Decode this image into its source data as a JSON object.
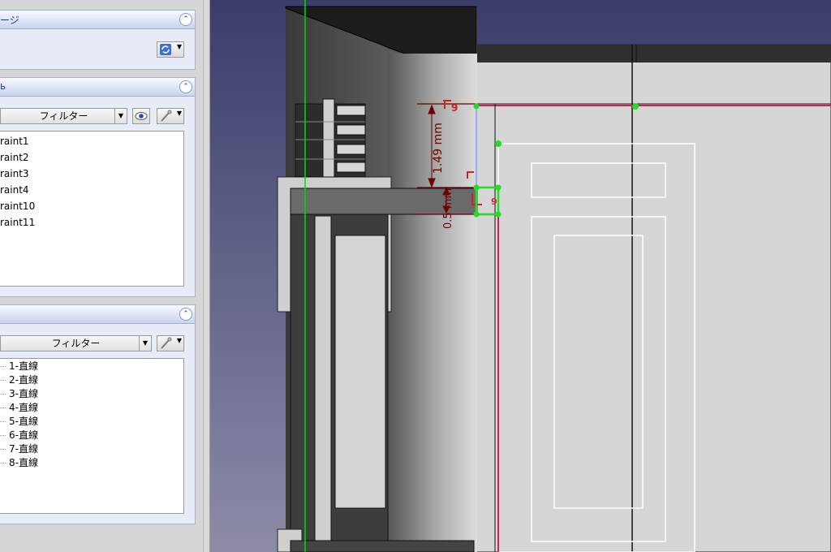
{
  "tasks_panel": {
    "page_title_partial": "ージ"
  },
  "constraints_panel": {
    "title_partial": "ь",
    "filter_label": "フィルター",
    "items": [
      "raint1",
      "raint2",
      "raint3",
      "raint4",
      "raint10",
      "raint11"
    ]
  },
  "elements_panel": {
    "filter_label": "フィルター",
    "items": [
      "1-直線",
      "2-直線",
      "3-直線",
      "4-直線",
      "5-直線",
      "6-直線",
      "7-直線",
      "8-直線"
    ]
  },
  "sketch": {
    "dim_vertical_1": "1.49 mm",
    "dim_vertical_2": "0.5 mm",
    "dim_label_top": "9",
    "dim_label_small": "9",
    "colors": {
      "background_top": "#3a3d6c",
      "background_bottom": "#8c8ca8",
      "axis_green": "#00dd00",
      "constraint_line": "#cc2255",
      "dimension": "#6e0000",
      "selected": "#22dd22"
    }
  },
  "icons": [
    "collapse-icon",
    "refresh-icon",
    "eye-icon",
    "tool-icon",
    "dropdown-arrow-icon"
  ]
}
